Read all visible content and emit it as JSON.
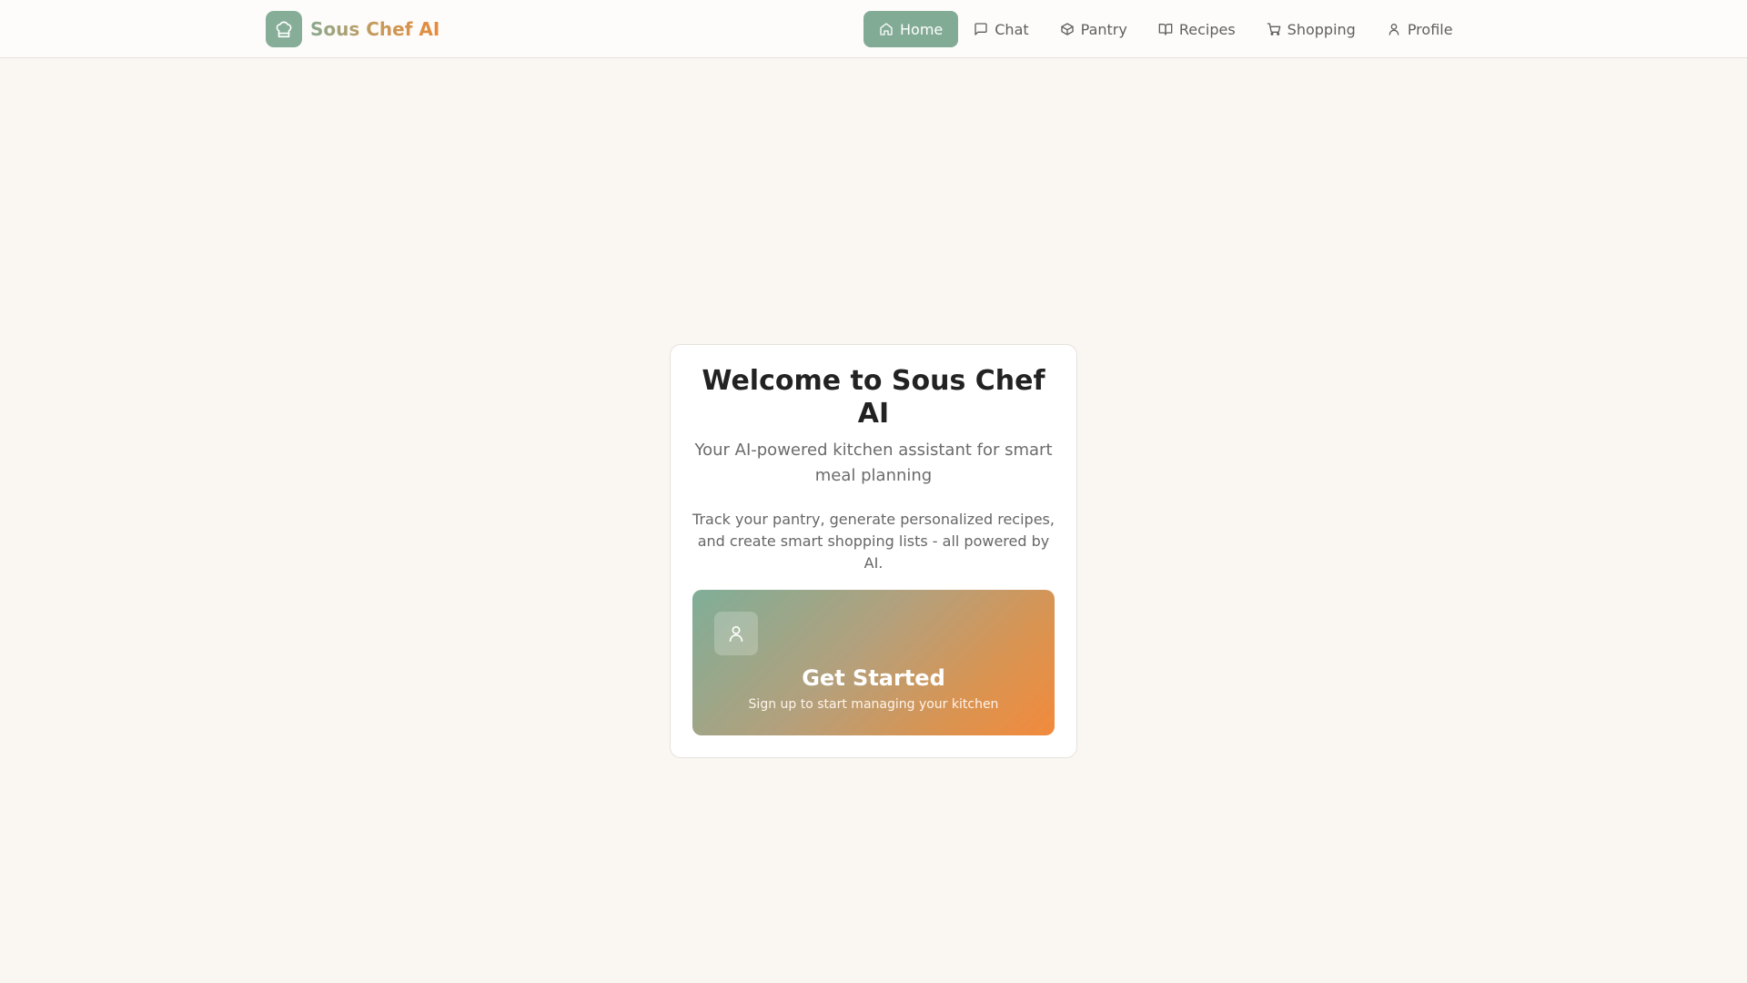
{
  "app": {
    "name": "Sous Chef AI",
    "logo_icon": "chef-hat-icon"
  },
  "nav": {
    "active": "Home",
    "items": [
      {
        "label": "Home",
        "icon": "home-icon"
      },
      {
        "label": "Chat",
        "icon": "chat-icon"
      },
      {
        "label": "Pantry",
        "icon": "box-icon"
      },
      {
        "label": "Recipes",
        "icon": "book-icon"
      },
      {
        "label": "Shopping",
        "icon": "cart-icon"
      },
      {
        "label": "Profile",
        "icon": "user-icon"
      }
    ]
  },
  "welcome": {
    "title": "Welcome to Sous Chef AI",
    "subtitle": "Your AI-powered kitchen assistant for smart meal planning",
    "description": "Track your pantry, generate personalized recipes, and create smart shopping lists - all powered by AI.",
    "cta": {
      "icon": "user-icon",
      "title": "Get Started",
      "subtitle": "Sign up to start managing your kitchen"
    }
  },
  "colors": {
    "accent": "#82ab95",
    "gradient_start": "#7fae98",
    "gradient_end": "#f28a3c",
    "background": "#faf7f3"
  }
}
